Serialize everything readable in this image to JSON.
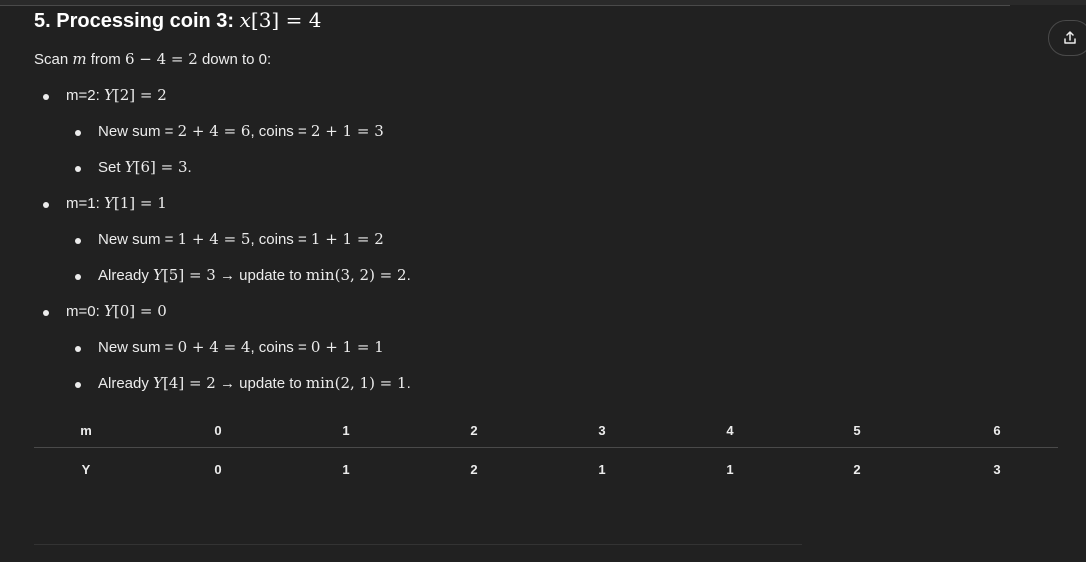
{
  "heading": {
    "prefix": "5. Processing coin 3: ",
    "math_var": "x",
    "math_rest": "[3] = 4"
  },
  "intro": {
    "prefix": "Scan ",
    "var": "m",
    "mid": " from ",
    "expr": "6 − 4 = 2",
    "suffix": " down to 0:"
  },
  "items": [
    {
      "label": "m=2: ",
      "var": "Y",
      "expr": "[2] = 2",
      "sub": [
        {
          "pre": "New sum = ",
          "e1": "2 + 4 = 6",
          "mid": ", coins = ",
          "e2": "2 + 1 = 3",
          "post": ""
        },
        {
          "pre": "Set ",
          "var": "Y",
          "e1": "[6] = 3",
          "post": "."
        }
      ]
    },
    {
      "label": "m=1: ",
      "var": "Y",
      "expr": "[1] = 1",
      "sub": [
        {
          "pre": "New sum = ",
          "e1": "1 + 4 = 5",
          "mid": ", coins = ",
          "e2": "1 + 1 = 2",
          "post": ""
        },
        {
          "pre": "Already ",
          "var": "Y",
          "e1": "[5] = 3",
          "mid": " → update to ",
          "e2": "min(3, 2) = 2",
          "post": "."
        }
      ]
    },
    {
      "label": "m=0: ",
      "var": "Y",
      "expr": "[0] = 0",
      "sub": [
        {
          "pre": "New sum = ",
          "e1": "0 + 4 = 4",
          "mid": ", coins = ",
          "e2": "0 + 1 = 1",
          "post": ""
        },
        {
          "pre": "Already ",
          "var": "Y",
          "e1": "[4] = 2",
          "mid": " → update to ",
          "e2": "min(2, 1) = 1",
          "post": "."
        }
      ]
    }
  ],
  "table": {
    "headers": [
      "m",
      "0",
      "1",
      "2",
      "3",
      "4",
      "5",
      "6"
    ],
    "row": [
      "Y",
      "0",
      "1",
      "2",
      "1",
      "1",
      "2",
      "3"
    ]
  },
  "share_icon": "share-icon"
}
